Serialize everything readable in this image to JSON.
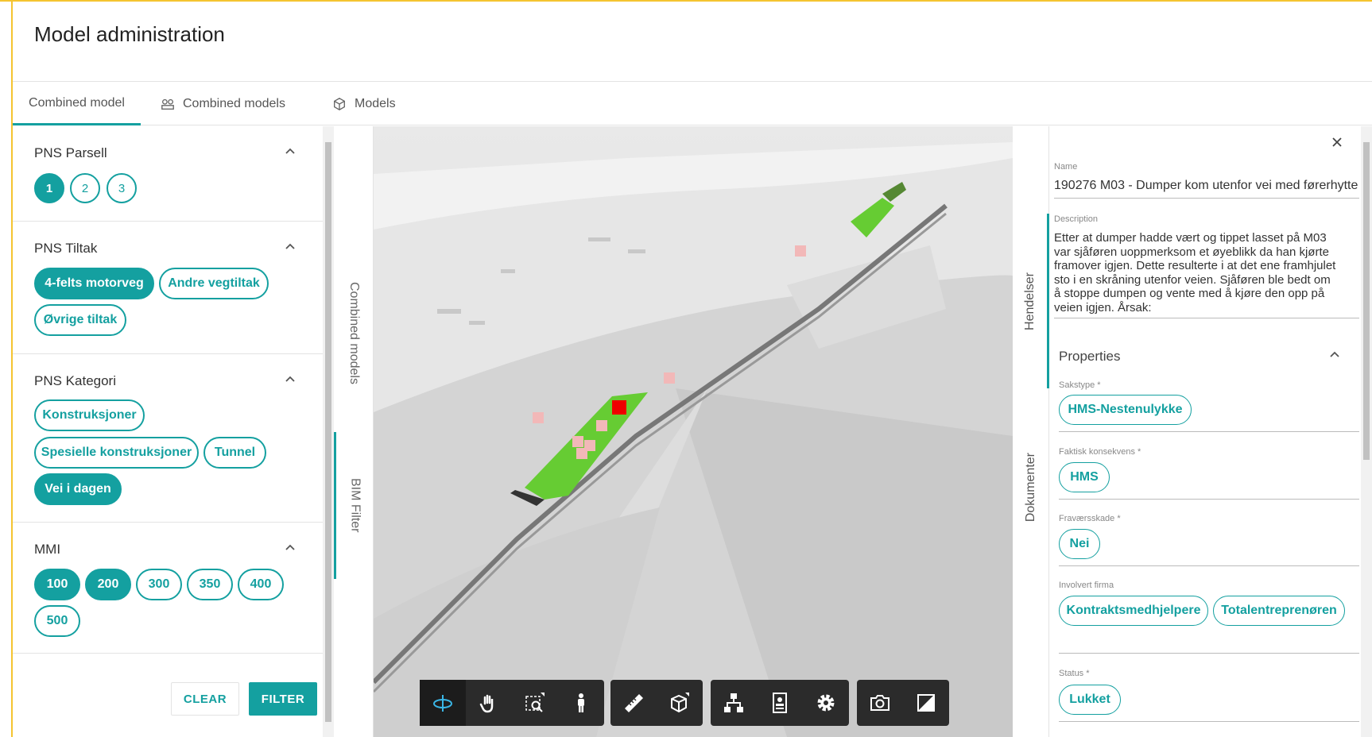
{
  "page": {
    "title": "Model administration"
  },
  "tabs": [
    {
      "label": "Combined model",
      "icon": "none"
    },
    {
      "label": "Combined models",
      "icon": "group-icon"
    },
    {
      "label": "Models",
      "icon": "cube-icon"
    }
  ],
  "filters": {
    "parsell": {
      "title": "PNS Parsell",
      "options": [
        "1",
        "2",
        "3"
      ],
      "selected": [
        "1"
      ]
    },
    "tiltak": {
      "title": "PNS Tiltak",
      "options": [
        "4-felts motorveg",
        "Andre vegtiltak",
        "Øvrige tiltak"
      ],
      "selected": [
        "4-felts motorveg"
      ]
    },
    "kategori": {
      "title": "PNS Kategori",
      "options": [
        "Konstruksjoner",
        "Spesielle konstruksjoner",
        "Tunnel",
        "Vei i dagen"
      ],
      "selected": [
        "Vei i dagen"
      ]
    },
    "mmi": {
      "title": "MMI",
      "options": [
        "100",
        "200",
        "300",
        "350",
        "400",
        "500"
      ],
      "selected": [
        "100",
        "200"
      ]
    },
    "clear_label": "CLEAR",
    "filter_label": "FILTER"
  },
  "side_tabs": {
    "combined_models": "Combined models",
    "bim_filter": "BIM Filter"
  },
  "right_tabs": {
    "hendelser": "Hendelser",
    "dokumenter": "Dokumenter"
  },
  "details": {
    "name_label": "Name",
    "name_value": "190276 M03 - Dumper kom utenfor vei med førerhytte",
    "description_label": "Description",
    "description_lines": [
      "Etter at dumper hadde vært og tippet lasset på M03",
      "var sjåføren uoppmerksom et øyeblikk da han kjørte",
      "framover igjen. Dette resulterte i at det ene framhjulet",
      "sto i en skråning utenfor veien. Sjåføren ble bedt om",
      "å stoppe dumpen og vente med å kjøre den opp på",
      "veien igjen. Årsak:"
    ],
    "properties_title": "Properties",
    "sakstype_label": "Sakstype *",
    "sakstype_value": "HMS-Nestenulykke",
    "konsekvens_label": "Faktisk konsekvens *",
    "konsekvens_value": "HMS",
    "fravaer_label": "Fraværsskade *",
    "fravaer_value": "Nei",
    "firma_label": "Involvert firma",
    "firma_values": [
      "Kontraktsmedhjelpere",
      "Totalentreprenøren"
    ],
    "status_label": "Status *",
    "status_value": "Lukket"
  },
  "toolbar": {
    "groups": [
      [
        "orbit-icon",
        "pan-icon",
        "zoom-window-icon",
        "walk-icon"
      ],
      [
        "measure-icon",
        "section-box-icon"
      ],
      [
        "model-tree-icon",
        "properties-icon",
        "settings-icon"
      ],
      [
        "camera-icon",
        "fullscreen-icon"
      ]
    ],
    "active": "orbit-icon"
  },
  "colors": {
    "accent": "#14a0a0",
    "highlight": "#f5c431",
    "marker": "#ee0000",
    "marker_light": "#f2b8b8",
    "model_green": "#66cc33"
  }
}
